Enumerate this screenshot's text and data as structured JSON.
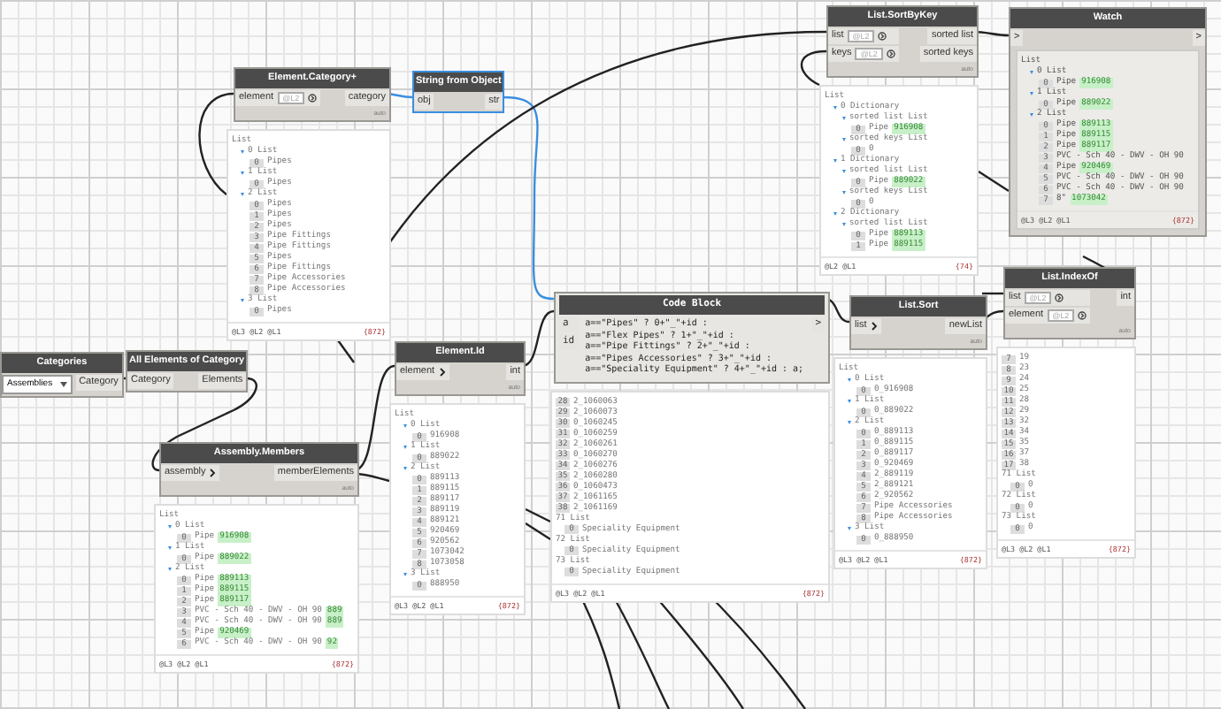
{
  "nodes": [
    {
      "kind": "node",
      "title": "Element.Category+",
      "selected": false,
      "inputs": [
        {
          "name": "element",
          "list_level": "@L2",
          "chevron": false
        }
      ],
      "outputs": [
        "category"
      ],
      "lacing": "auto",
      "preview": {
        "tree": {
          "label": "List",
          "children": [
            {
              "label": "0 List",
              "children": [
                {
                  "index": "0",
                  "text": "Pipes"
                }
              ]
            },
            {
              "label": "1 List",
              "children": [
                {
                  "index": "0",
                  "text": "Pipes"
                }
              ]
            },
            {
              "label": "2 List",
              "children": [
                {
                  "index": "0",
                  "text": "Pipes"
                },
                {
                  "index": "1",
                  "text": "Pipes"
                },
                {
                  "index": "2",
                  "text": "Pipes"
                },
                {
                  "index": "3",
                  "text": "Pipe Fittings"
                },
                {
                  "index": "4",
                  "text": "Pipe Fittings"
                },
                {
                  "index": "5",
                  "text": "Pipes"
                },
                {
                  "index": "6",
                  "text": "Pipe Fittings"
                },
                {
                  "index": "7",
                  "text": "Pipe Accessories"
                },
                {
                  "index": "8",
                  "text": "Pipe Accessories"
                }
              ]
            },
            {
              "label": "3 List",
              "children": [
                {
                  "index": "0",
                  "text": "Pipes"
                }
              ]
            }
          ]
        },
        "levels": "@L3 @L2 @L1",
        "count": "{872}"
      }
    },
    {
      "kind": "node",
      "title": "String from Object",
      "selected": true,
      "inputs": [
        {
          "name": "obj",
          "chevron": false
        }
      ],
      "outputs": [
        "str"
      ]
    },
    {
      "kind": "node",
      "title": "List.SortByKey",
      "selected": false,
      "inputs": [
        {
          "name": "list",
          "list_level": "@L2",
          "chevron": false
        },
        {
          "name": "keys",
          "list_level": "@L2",
          "chevron": false
        }
      ],
      "outputs": [
        "sorted list",
        "sorted keys"
      ],
      "lacing": "auto",
      "preview": {
        "tree": {
          "label": "List",
          "children": [
            {
              "label": "0 Dictionary",
              "children": [
                {
                  "label": "sorted list List",
                  "children": [
                    {
                      "index": "0",
                      "text": "Pipe",
                      "value": "916908"
                    }
                  ]
                },
                {
                  "label": "sorted keys List",
                  "children": [
                    {
                      "index": "0",
                      "text": "0"
                    }
                  ]
                }
              ]
            },
            {
              "label": "1 Dictionary",
              "children": [
                {
                  "label": "sorted list List",
                  "children": [
                    {
                      "index": "0",
                      "text": "Pipe",
                      "value": "889022"
                    }
                  ]
                },
                {
                  "label": "sorted keys List",
                  "children": [
                    {
                      "index": "0",
                      "text": "0"
                    }
                  ]
                }
              ]
            },
            {
              "label": "2 Dictionary",
              "children": [
                {
                  "label": "sorted list List",
                  "children": [
                    {
                      "index": "0",
                      "text": "Pipe",
                      "value": "889113"
                    },
                    {
                      "index": "1",
                      "text": "Pipe",
                      "value": "889115"
                    }
                  ]
                }
              ]
            }
          ]
        },
        "levels": "@L2 @L1",
        "count": "{74}"
      }
    },
    {
      "kind": "watch",
      "title": "Watch",
      "selected": false,
      "inputs": [
        {
          "name": ">",
          "chevron": false
        }
      ],
      "outputs": [
        ">"
      ],
      "preview": {
        "tree": {
          "label": "List",
          "children": [
            {
              "label": "0 List",
              "children": [
                {
                  "index": "0",
                  "text": "Pipe",
                  "value": "916908"
                }
              ]
            },
            {
              "label": "1 List",
              "children": [
                {
                  "index": "0",
                  "text": "Pipe",
                  "value": "889022"
                }
              ]
            },
            {
              "label": "2 List",
              "children": [
                {
                  "index": "0",
                  "text": "Pipe",
                  "value": "889113"
                },
                {
                  "index": "1",
                  "text": "Pipe",
                  "value": "889115"
                },
                {
                  "index": "2",
                  "text": "Pipe",
                  "value": "889117"
                },
                {
                  "index": "3",
                  "text": "PVC - Sch 40 - DWV - OH 90"
                },
                {
                  "index": "4",
                  "text": "Pipe",
                  "value": "920469"
                },
                {
                  "index": "5",
                  "text": "PVC - Sch 40 - DWV - OH 90"
                },
                {
                  "index": "6",
                  "text": "PVC - Sch 40 - DWV - OH 90"
                },
                {
                  "index": "7",
                  "text": "8\"",
                  "value": "1073042"
                }
              ]
            }
          ]
        },
        "levels": "@L3 @L2 @L1",
        "count": "{872}"
      }
    },
    {
      "kind": "dropdown",
      "title": "Categories",
      "selected": false,
      "dropdown": "Assemblies",
      "outputs": [
        "Category"
      ]
    },
    {
      "kind": "node",
      "title": "All Elements of Category",
      "selected": false,
      "inputs": [
        {
          "name": "Category",
          "chevron": false
        }
      ],
      "outputs": [
        "Elements"
      ]
    },
    {
      "kind": "node",
      "title": "Assembly.Members",
      "selected": false,
      "inputs": [
        {
          "name": "assembly",
          "chevron": true
        }
      ],
      "outputs": [
        "memberElements"
      ],
      "lacing": "auto",
      "preview": {
        "tree": {
          "label": "List",
          "children": [
            {
              "label": "0 List",
              "children": [
                {
                  "index": "0",
                  "text": "Pipe",
                  "value": "916908"
                }
              ]
            },
            {
              "label": "1 List",
              "children": [
                {
                  "index": "0",
                  "text": "Pipe",
                  "value": "889022"
                }
              ]
            },
            {
              "label": "2 List",
              "children": [
                {
                  "index": "0",
                  "text": "Pipe",
                  "value": "889113"
                },
                {
                  "index": "1",
                  "text": "Pipe",
                  "value": "889115"
                },
                {
                  "index": "2",
                  "text": "Pipe",
                  "value": "889117"
                },
                {
                  "index": "3",
                  "text": "PVC - Sch 40 - DWV - OH 90",
                  "value": "889"
                },
                {
                  "index": "4",
                  "text": "PVC - Sch 40 - DWV - OH 90",
                  "value": "889"
                },
                {
                  "index": "5",
                  "text": "Pipe",
                  "value": "920469"
                },
                {
                  "index": "6",
                  "text": "PVC - Sch 40 - DWV - OH 90",
                  "value": "92"
                }
              ]
            }
          ]
        },
        "levels": "@L3 @L2 @L1",
        "count": "{872}"
      }
    },
    {
      "kind": "node",
      "title": "Element.Id",
      "selected": false,
      "inputs": [
        {
          "name": "element",
          "chevron": true
        }
      ],
      "outputs": [
        "int"
      ],
      "lacing": "auto",
      "preview": {
        "tree": {
          "label": "List",
          "children": [
            {
              "label": "0 List",
              "children": [
                {
                  "index": "0",
                  "text": "916908"
                }
              ]
            },
            {
              "label": "1 List",
              "children": [
                {
                  "index": "0",
                  "text": "889022"
                }
              ]
            },
            {
              "label": "2 List",
              "children": [
                {
                  "index": "0",
                  "text": "889113"
                },
                {
                  "index": "1",
                  "text": "889115"
                },
                {
                  "index": "2",
                  "text": "889117"
                },
                {
                  "index": "3",
                  "text": "889119"
                },
                {
                  "index": "4",
                  "text": "889121"
                },
                {
                  "index": "5",
                  "text": "920469"
                },
                {
                  "index": "6",
                  "text": "920562"
                },
                {
                  "index": "7",
                  "text": "1073042"
                },
                {
                  "index": "8",
                  "text": "1073058"
                }
              ]
            },
            {
              "label": "3 List",
              "children": [
                {
                  "index": "0",
                  "text": "888950"
                }
              ]
            }
          ]
        },
        "levels": "@L3 @L2 @L1",
        "count": "{872}"
      }
    },
    {
      "kind": "code",
      "title": "Code Block",
      "selected": false,
      "inputs": [
        {
          "name": "a",
          "chevron": false
        },
        {
          "name": "id",
          "chevron": false
        }
      ],
      "outputs": [
        ">"
      ],
      "code": [
        "a==\"Pipes\" ? 0+\"_\"+id :",
        "a==\"Flex Pipes\" ? 1+\"_\"+id :",
        "a==\"Pipe Fittings\" ? 2+\"_\"+id :",
        "a==\"Pipes Accessories\" ? 3+\"_\"+id :",
        "a==\"Speciality Equipment\" ? 4+\"_\"+id : a;"
      ],
      "preview": {
        "tree": {
          "children": [
            {
              "index": "28",
              "text": "2_1060063"
            },
            {
              "index": "29",
              "text": "2_1060073"
            },
            {
              "index": "30",
              "text": "0_1060245"
            },
            {
              "index": "31",
              "text": "0_1060259"
            },
            {
              "index": "32",
              "text": "2_1060261"
            },
            {
              "index": "33",
              "text": "0_1060270"
            },
            {
              "index": "34",
              "text": "2_1060276"
            },
            {
              "index": "35",
              "text": "2_1060280"
            },
            {
              "index": "36",
              "text": "0_1060473"
            },
            {
              "index": "37",
              "text": "2_1061165"
            },
            {
              "index": "38",
              "text": "2_1061169"
            },
            {
              "label": "71 List",
              "children": [
                {
                  "index": "0",
                  "text": "Speciality Equipment"
                }
              ]
            },
            {
              "label": "72 List",
              "children": [
                {
                  "index": "0",
                  "text": "Speciality Equipment"
                }
              ]
            },
            {
              "label": "73 List",
              "children": [
                {
                  "index": "0",
                  "text": "Speciality Equipment"
                }
              ]
            }
          ]
        },
        "levels": "@L3 @L2 @L1",
        "count": "{872}"
      }
    },
    {
      "kind": "node",
      "title": "List.Sort",
      "selected": false,
      "inputs": [
        {
          "name": "list",
          "chevron": true
        }
      ],
      "outputs": [
        "newList"
      ],
      "lacing": "auto",
      "preview": {
        "tree": {
          "label": "List",
          "children": [
            {
              "label": "0 List",
              "children": [
                {
                  "index": "0",
                  "text": "0_916908"
                }
              ]
            },
            {
              "label": "1 List",
              "children": [
                {
                  "index": "0",
                  "text": "0_889022"
                }
              ]
            },
            {
              "label": "2 List",
              "children": [
                {
                  "index": "0",
                  "text": "0_889113"
                },
                {
                  "index": "1",
                  "text": "0_889115"
                },
                {
                  "index": "2",
                  "text": "0_889117"
                },
                {
                  "index": "3",
                  "text": "0_920469"
                },
                {
                  "index": "4",
                  "text": "2_889119"
                },
                {
                  "index": "5",
                  "text": "2_889121"
                },
                {
                  "index": "6",
                  "text": "2_920562"
                },
                {
                  "index": "7",
                  "text": "Pipe Accessories"
                },
                {
                  "index": "8",
                  "text": "Pipe Accessories"
                }
              ]
            },
            {
              "label": "3 List",
              "children": [
                {
                  "index": "0",
                  "text": "0_888950"
                }
              ]
            }
          ]
        },
        "levels": "@L3 @L2 @L1",
        "count": "{872}"
      }
    },
    {
      "kind": "node",
      "title": "List.IndexOf",
      "selected": false,
      "inputs": [
        {
          "name": "list",
          "list_level": "@L2",
          "chevron": false
        },
        {
          "name": "element",
          "list_level": "@L2",
          "chevron": false
        }
      ],
      "outputs": [
        "int"
      ],
      "lacing": "auto",
      "preview": {
        "tree": {
          "children": [
            {
              "index": "7",
              "text": "19"
            },
            {
              "index": "8",
              "text": "23"
            },
            {
              "index": "9",
              "text": "24"
            },
            {
              "index": "10",
              "text": "25"
            },
            {
              "index": "11",
              "text": "28"
            },
            {
              "index": "12",
              "text": "29"
            },
            {
              "index": "13",
              "text": "32"
            },
            {
              "index": "14",
              "text": "34"
            },
            {
              "index": "15",
              "text": "35"
            },
            {
              "index": "16",
              "text": "37"
            },
            {
              "index": "17",
              "text": "38"
            },
            {
              "label": "71 List",
              "children": [
                {
                  "index": "0",
                  "text": "0"
                }
              ]
            },
            {
              "label": "72 List",
              "children": [
                {
                  "index": "0",
                  "text": "0"
                }
              ]
            },
            {
              "label": "73 List",
              "children": [
                {
                  "index": "0",
                  "text": "0"
                }
              ]
            }
          ]
        },
        "levels": "@L3 @L2 @L1",
        "count": "{872}"
      }
    }
  ]
}
